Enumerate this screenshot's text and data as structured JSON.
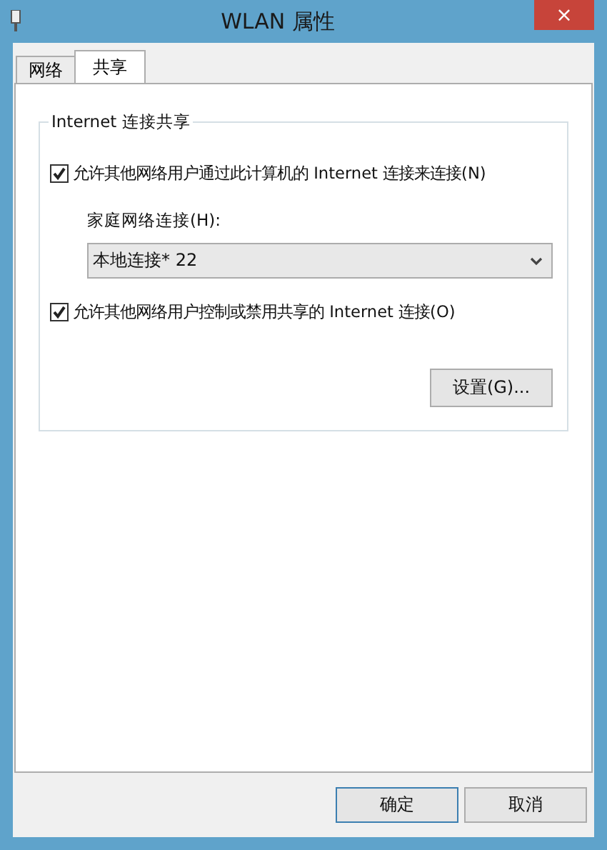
{
  "window": {
    "title": "WLAN 属性",
    "close": "×"
  },
  "tabs": [
    {
      "label": "网络",
      "selected": false
    },
    {
      "label": "共享",
      "selected": true
    }
  ],
  "group": {
    "title": "Internet 连接共享",
    "allow_connect": {
      "label": "允许其他网络用户通过此计算机的 Internet 连接来连接(N)",
      "checked": true
    },
    "home_network": {
      "label": "家庭网络连接(H):",
      "value": "本地连接* 22"
    },
    "allow_control": {
      "label": "允许其他网络用户控制或禁用共享的 Internet 连接(O)",
      "checked": true
    },
    "settings_button": "设置(G)..."
  },
  "buttons": [
    {
      "label": "确定",
      "selected": true
    },
    {
      "label": "取消",
      "selected": false
    }
  ]
}
